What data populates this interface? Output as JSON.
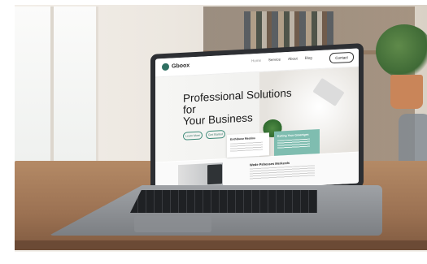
{
  "website": {
    "brand": "Gboox",
    "nav": {
      "items": [
        "Home",
        "Service",
        "About",
        "Blog"
      ],
      "contact_label": "Contact"
    },
    "hero": {
      "title_line1": "Professional Solutions for",
      "title_line2": "Your Business",
      "btn1_label": "Learn More",
      "btn2_label": "Get Started"
    },
    "cards": [
      {
        "title": "Enthibuse Meatins"
      },
      {
        "title": "Exiting Your Greentges"
      }
    ],
    "section2_title": "Wede Pshesses Merkerds"
  },
  "colors": {
    "accent": "#2f6f62",
    "card_teal": "#7fbdb0"
  }
}
